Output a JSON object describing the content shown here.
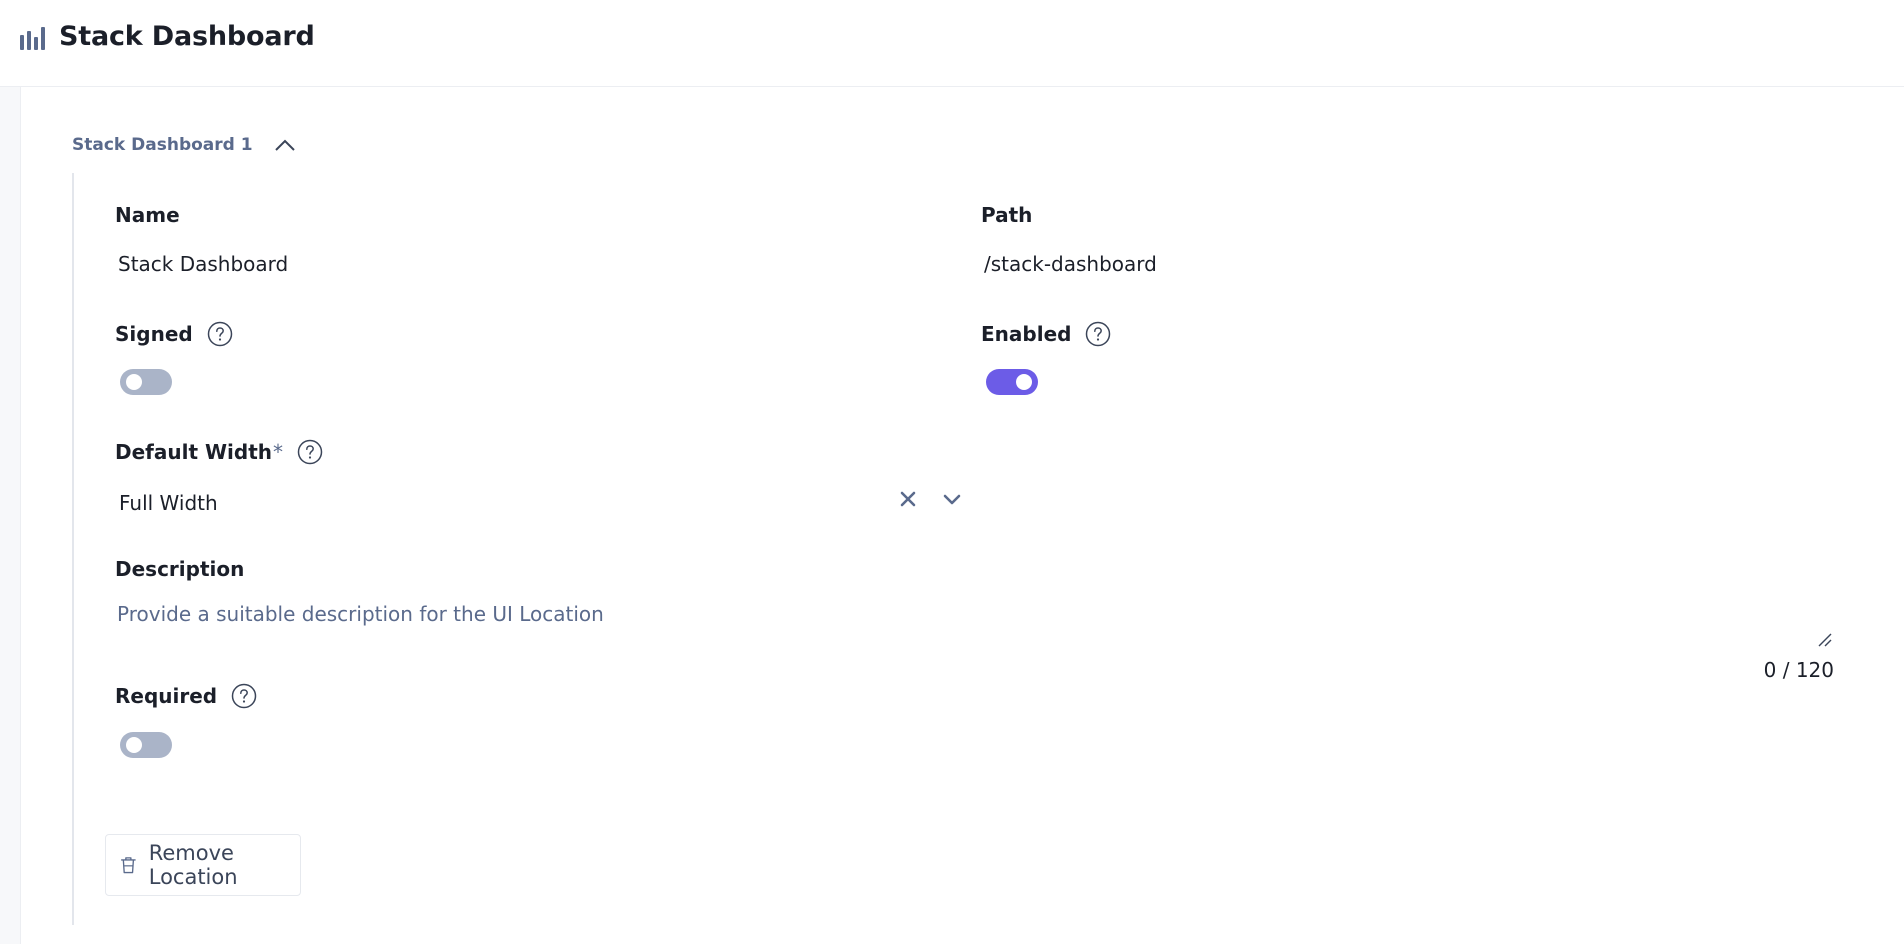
{
  "header": {
    "title": "Stack Dashboard",
    "icon": "bar-chart-icon"
  },
  "section": {
    "title": "Stack Dashboard 1",
    "toggle_icon": "chevron-up-icon"
  },
  "fields": {
    "name": {
      "label": "Name",
      "value": "Stack Dashboard"
    },
    "path": {
      "label": "Path",
      "value": "/stack-dashboard"
    },
    "signed": {
      "label": "Signed",
      "on": false
    },
    "enabled": {
      "label": "Enabled",
      "on": true
    },
    "default_width": {
      "label": "Default Width",
      "required_mark": "*",
      "value": "Full Width"
    },
    "description": {
      "label": "Description",
      "value": "",
      "placeholder": "Provide a suitable description for the UI Location",
      "counter": "0 / 120"
    },
    "required": {
      "label": "Required",
      "on": false
    }
  },
  "actions": {
    "remove_label": "Remove Location"
  },
  "colors": {
    "accent": "#6c5ce7",
    "toggle_off": "#aab4c8",
    "muted_text": "#5a6a8c"
  }
}
